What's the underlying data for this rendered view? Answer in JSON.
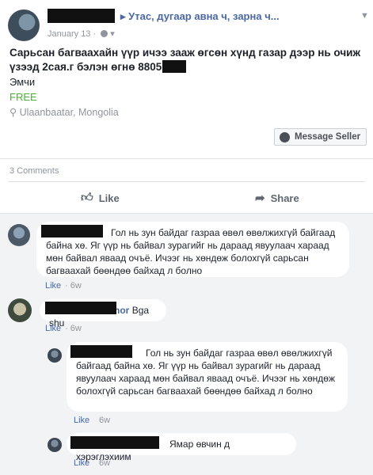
{
  "post": {
    "group_name": "Утас, дугаар авна ч, зарна ч...",
    "date": "January 13 ·",
    "caret": "▼",
    "title": "Сарьсан багваахайн үүр ичээ зааж өгсөн хүнд газар дээр нь очиж үзээд 2сая.г бэлэн өгнө 8805",
    "category": "Эмчи",
    "price": "FREE",
    "location": "Ulaanbaatar, Mongolia",
    "message_button": "Message Seller",
    "comments_count": "3 Comments",
    "like_label": "Like",
    "share_label": "Share"
  },
  "comments": [
    {
      "text": "Гол нь зун байдаг газраа өвөл өвөлжихгүй байгаад байна хө. Яг үүр нь байвал зурагийг нь дараад явуулаач харaад мөн байвал яваад очъё. Ичээг нь хөндөж болохгүй сарьсан багваахай бөөндөө байхад л болно",
      "like": "Like",
      "time": "· 6w"
    },
    {
      "name_suffix": "hor",
      "text": "Bga shu",
      "like": "Like",
      "time": "· 6w"
    },
    {
      "text": "Гол нь зун байдаг газраа өвөл өвөлжихгүй байгаад байна хө. Яг үүр нь байвал зурагийг нь дараад явуулаач харaад мөн байвал яваад очъё. Ичээг нь хөндөж болохгүй сарьсан багваахай бөөндөө байхад л болно",
      "like": "Like",
      "time": "6w"
    },
    {
      "text": "Ямар өвчин д хэрэглэхиим",
      "like": "Like",
      "time": "6w"
    }
  ]
}
